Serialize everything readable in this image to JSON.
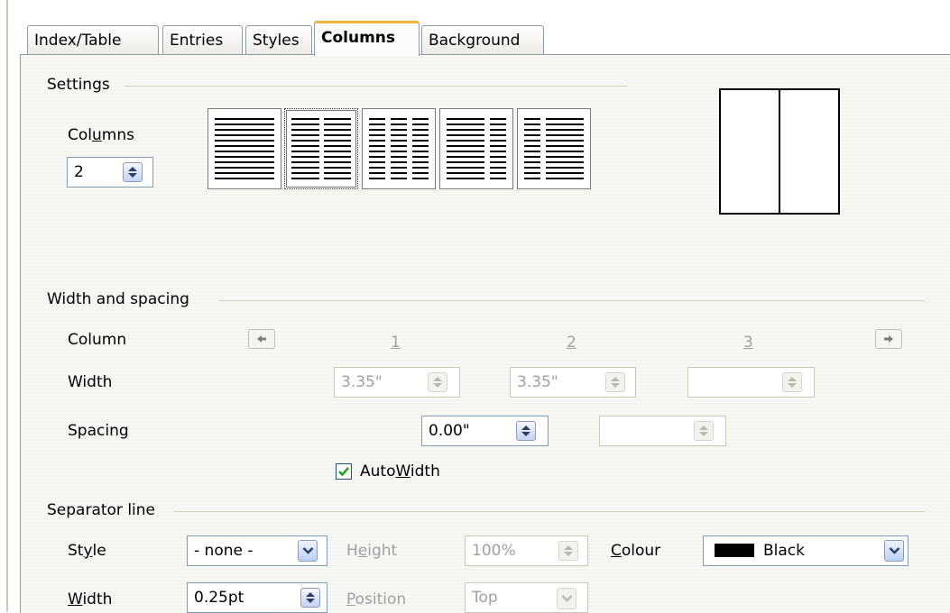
{
  "tabs": [
    {
      "label": "Index/Table"
    },
    {
      "label": "Entries"
    },
    {
      "label": "Styles"
    },
    {
      "label": "Columns"
    },
    {
      "label": "Background"
    }
  ],
  "settings": {
    "group_title": "Settings",
    "columns_label_a": "Col",
    "columns_label_u": "u",
    "columns_label_b": "mns",
    "columns_value": "2"
  },
  "width_spacing": {
    "group_title": "Width and spacing",
    "column_label": "Column",
    "col_numbers": [
      "1",
      "2",
      "3"
    ],
    "width_label": "Width",
    "width_values": [
      "3.35\"",
      "3.35\"",
      ""
    ],
    "spacing_label": "Spacing",
    "spacing_values": [
      "0.00\"",
      ""
    ],
    "autowidth_a": "Auto",
    "autowidth_u": "W",
    "autowidth_b": "idth",
    "autowidth_checked": true
  },
  "separator": {
    "group_title": "Separator line",
    "style_label_a": "St",
    "style_label_u": "y",
    "style_label_b": "le",
    "style_value": "- none -",
    "height_label_a": "H",
    "height_label_u": "e",
    "height_label_b": "ight",
    "height_value": "100%",
    "colour_label_u": "C",
    "colour_label_b": "olour",
    "colour_value": "Black",
    "colour_swatch": "#000000",
    "width_label_u": "W",
    "width_label_b": "idth",
    "width_value": "0.25pt",
    "position_label_u": "P",
    "position_label_b": "osition",
    "position_value": "Top"
  },
  "colors": {
    "active_tab_accent": "#f8b33a",
    "field_border": "#7f9db9",
    "disabled_text": "#a0a0a0"
  }
}
